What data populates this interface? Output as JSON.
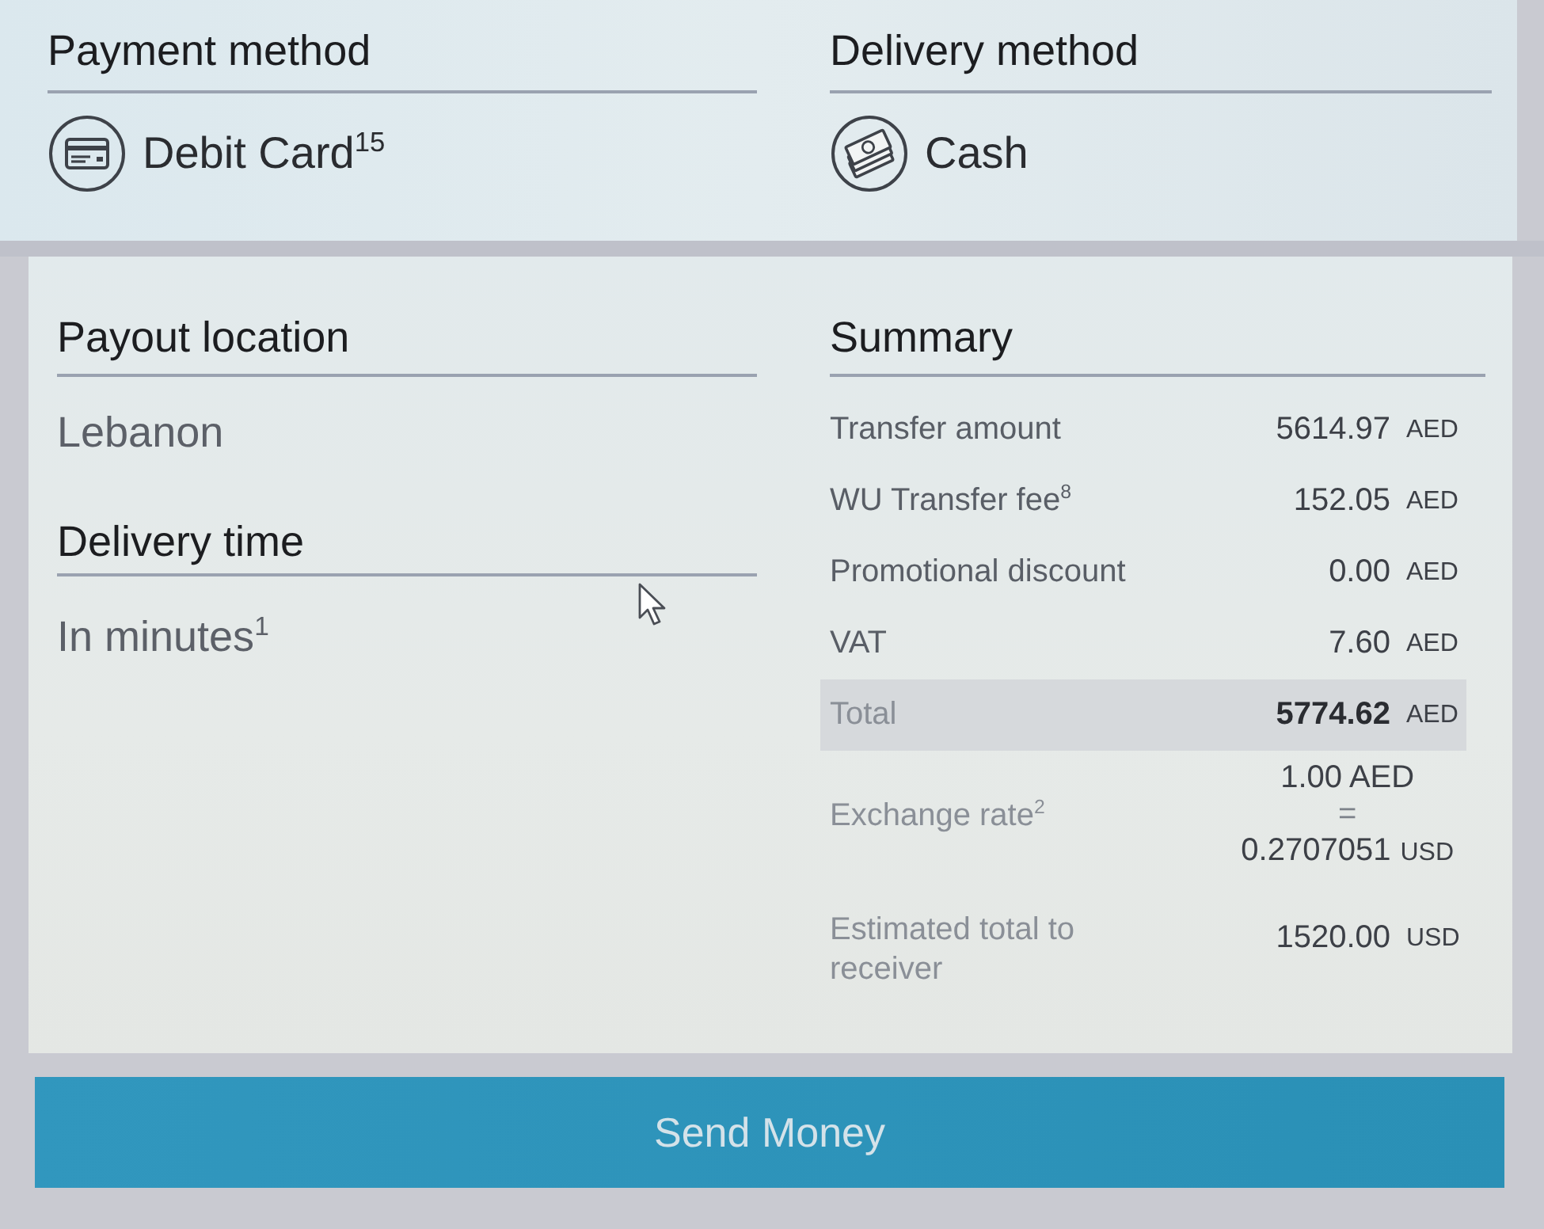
{
  "payment_method": {
    "heading": "Payment method",
    "value": "Debit Card$^{15}$"
  },
  "delivery_method": {
    "heading": "Delivery method",
    "value": "Cash"
  },
  "payout_location": {
    "heading": "Payout location",
    "value": "Lebanon"
  },
  "delivery_time": {
    "heading": "Delivery time",
    "value": "In minutes$^{1}$"
  },
  "summary": {
    "heading": "Summary",
    "rows": [
      {
        "kind": "line",
        "label": "Transfer amount",
        "amount": "5614.97",
        "currency": "AED"
      },
      {
        "kind": "line",
        "label": "WU Transfer fee$^{8}$",
        "amount": "152.05",
        "currency": "AED"
      },
      {
        "kind": "line",
        "label": "Promotional discount",
        "amount": "0.00",
        "currency": "AED"
      },
      {
        "kind": "line",
        "label": "VAT",
        "amount": "7.60",
        "currency": "AED"
      },
      {
        "kind": "total",
        "label": "Total",
        "amount": "5774.62",
        "currency": "AED"
      },
      {
        "kind": "rate",
        "label": "Exchange rate$^{2}$",
        "base": "1.00 AED",
        "equals": "=",
        "amount": "0.2707051",
        "currency": "USD"
      },
      {
        "kind": "estimate",
        "label": "Estimated total to receiver",
        "amount": "1520.00",
        "currency": "USD"
      }
    ]
  },
  "send_button": {
    "label": "Send Money"
  }
}
